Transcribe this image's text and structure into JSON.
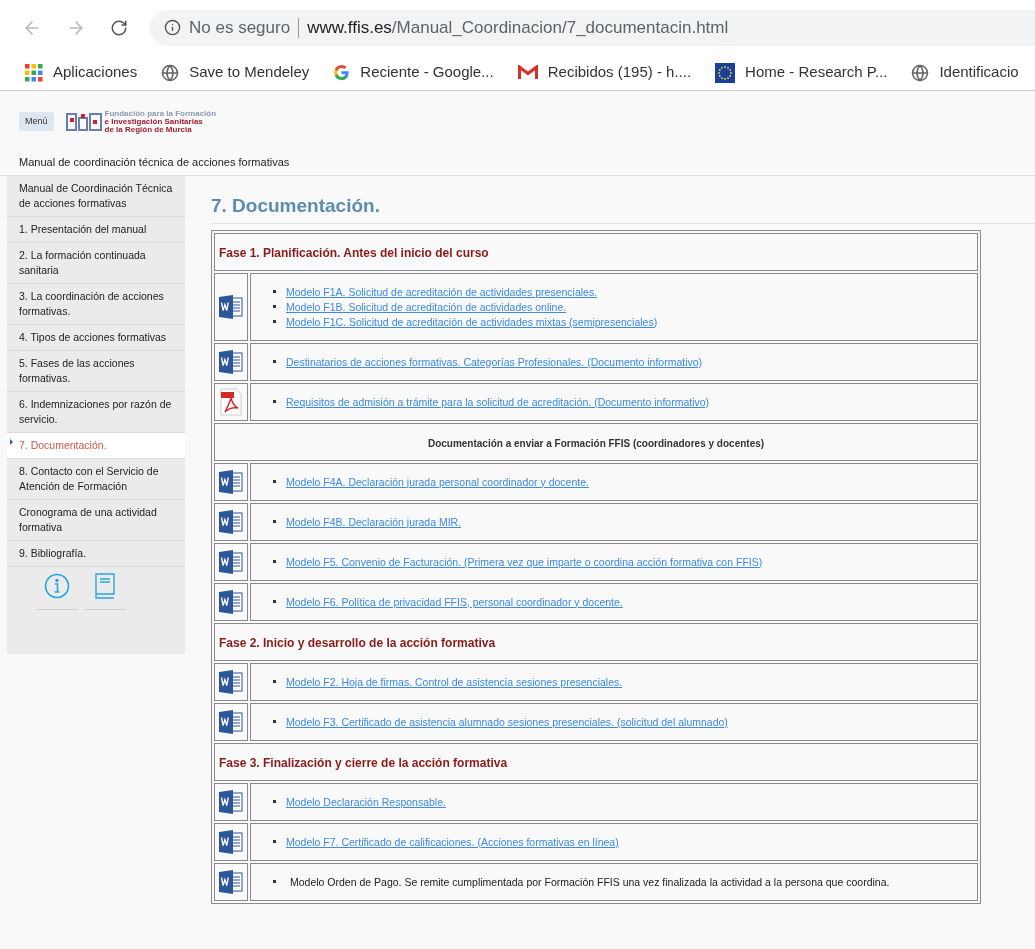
{
  "browser": {
    "security": "No es seguro",
    "host": "www.ffis.es",
    "path": "/Manual_Coordinacion/7_documentacin.html",
    "bookmarks": [
      {
        "kind": "apps",
        "label": "Aplicaciones"
      },
      {
        "kind": "globe",
        "label": "Save to Mendeley"
      },
      {
        "kind": "google",
        "label": "Reciente - Google..."
      },
      {
        "kind": "mail",
        "label": "Recibidos (195) - h...."
      },
      {
        "kind": "flag",
        "label": "Home - Research P..."
      },
      {
        "kind": "globe",
        "label": "Identificacio"
      }
    ]
  },
  "header": {
    "menu_button": "Menú",
    "logo_lines": [
      "Fundación para la Formación",
      "e Investigación Sanitarias",
      "de la Región de Murcia"
    ],
    "breadcrumb": "Manual de coordinación técnica de acciones formativas"
  },
  "sidebar": {
    "items": [
      {
        "label": "Manual de Coordinación Técnica de acciones formativas",
        "selected": false
      },
      {
        "label": "1. Presentación del manual",
        "selected": false
      },
      {
        "label": "2. La formación continuada sanitaria",
        "selected": false
      },
      {
        "label": "3. La coordinación de acciones formativas.",
        "selected": false
      },
      {
        "label": "4. Tipos de acciones formativas",
        "selected": false
      },
      {
        "label": "5. Fases de las acciones formativas.",
        "selected": false
      },
      {
        "label": "6. Indemnizaciones por razón de servicio.",
        "selected": false
      },
      {
        "label": "7. Documentación.",
        "selected": true
      },
      {
        "label": "8. Contacto con el Servicio de Atención de Formación",
        "selected": false
      },
      {
        "label": "Cronograma de una actividad formativa",
        "selected": false
      },
      {
        "label": "9. Bibliografía.",
        "selected": false
      }
    ]
  },
  "title": "7. Documentación.",
  "rows": [
    {
      "kind": "heading",
      "text": "Fase 1. Planificación. Antes del inicio del curso"
    },
    {
      "kind": "docs",
      "icon": {
        "kind": "word"
      },
      "items": [
        {
          "text": "Modelo F1A. Solicitud de acreditación de actividades presenciales.",
          "link": true
        },
        {
          "text": "Modelo F1B. Solicitud de acreditación de actividades online.",
          "link": true
        },
        {
          "text": "Modelo F1C. Solicitud de acreditación de actividades mixtas (semipresenciales)",
          "link": true
        }
      ]
    },
    {
      "kind": "docs",
      "icon": {
        "kind": "word"
      },
      "items": [
        {
          "text": "Destinatarios de acciones formativas. Categorías Profesionales. (Documento informativo)",
          "link": true
        }
      ]
    },
    {
      "kind": "docs",
      "icon": {
        "kind": "pdf"
      },
      "items": [
        {
          "text": "Requisitos de admisión a trámite para la solicitud de acreditación. (Documento informativo)",
          "link": true
        }
      ]
    },
    {
      "kind": "subheading",
      "text": "Documentación a enviar a Formación FFIS (coordinadores y docentes)"
    },
    {
      "kind": "docs",
      "icon": {
        "kind": "word"
      },
      "items": [
        {
          "text": "Modelo F4A. Declaración jurada personal coordinador y docente.",
          "link": true
        }
      ]
    },
    {
      "kind": "docs",
      "icon": {
        "kind": "word"
      },
      "items": [
        {
          "text": "Modelo F4B. Declaración jurada MIR.",
          "link": true
        }
      ]
    },
    {
      "kind": "docs",
      "icon": {
        "kind": "word"
      },
      "items": [
        {
          "text": "Modelo F5. Convenio de Facturación. (Primera vez que imparte o coordina acción formativa con FFIS)",
          "link": true
        }
      ]
    },
    {
      "kind": "docs",
      "icon": {
        "kind": "word"
      },
      "items": [
        {
          "text": "Modelo F6. Política de privacidad FFIS, personal coordinador y docente.",
          "link": true
        }
      ]
    },
    {
      "kind": "heading",
      "text": "Fase 2. Inicio y desarrollo de la acción formativa"
    },
    {
      "kind": "docs",
      "icon": {
        "kind": "word"
      },
      "items": [
        {
          "text": "Modelo F2. Hoja de firmas. Control de asistencia sesiones presenciales.",
          "link": true
        }
      ]
    },
    {
      "kind": "docs",
      "icon": {
        "kind": "word"
      },
      "items": [
        {
          "text": "Modelo F3. Certificado de asistencia alumnado sesiones presenciales. (solicitud del alumnado)",
          "link": true
        }
      ]
    },
    {
      "kind": "heading",
      "text": "Fase 3. Finalización y cierre de la acción formativa"
    },
    {
      "kind": "docs",
      "icon": {
        "kind": "word"
      },
      "items": [
        {
          "text": "Modelo Declaración Responsable.",
          "link": true
        }
      ]
    },
    {
      "kind": "docs",
      "icon": {
        "kind": "word"
      },
      "items": [
        {
          "text": "Modelo F7. Certificado de calificaciones. (Acciones formativas en línea)",
          "link": true
        }
      ]
    },
    {
      "kind": "docs",
      "icon": {
        "kind": "word"
      },
      "items": [
        {
          "text": "Modelo Orden de Pago. Se remite cumplimentada por Formación FFIS una vez finalizada la actividad a la persona que coordina.",
          "link": false
        }
      ]
    }
  ]
}
